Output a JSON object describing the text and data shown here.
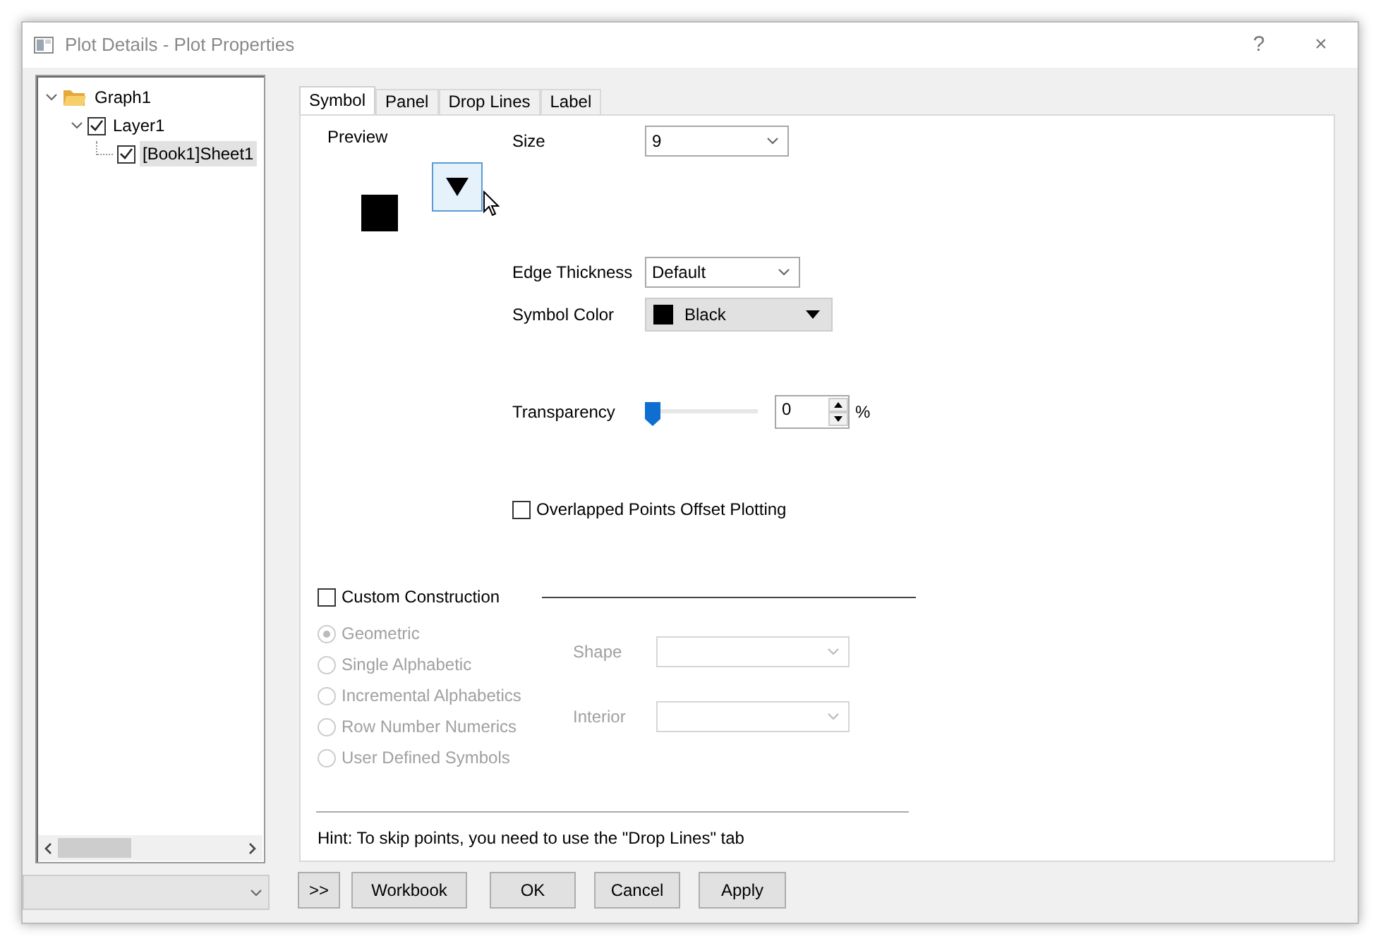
{
  "window": {
    "title": "Plot Details - Plot Properties",
    "help": "?",
    "close": "×"
  },
  "tree": [
    {
      "label": "Graph1",
      "kind": "folder",
      "expanded": true,
      "children": [
        {
          "label": "Layer1",
          "kind": "check",
          "checked": true,
          "expanded": true,
          "children": [
            {
              "label": "[Book1]Sheet1",
              "kind": "check",
              "checked": true,
              "selected": true
            }
          ]
        }
      ]
    }
  ],
  "tabs": [
    {
      "label": "Symbol",
      "selected": true
    },
    {
      "label": "Panel",
      "selected": false
    },
    {
      "label": "Drop Lines",
      "selected": false
    },
    {
      "label": "Label",
      "selected": false
    }
  ],
  "preview": {
    "label": "Preview"
  },
  "size": {
    "label": "Size",
    "value": "9"
  },
  "edge_thickness": {
    "label": "Edge Thickness",
    "value": "Default"
  },
  "symbol_color": {
    "label": "Symbol Color",
    "value": "Black"
  },
  "transparency": {
    "label": "Transparency",
    "level": 0,
    "value": "0",
    "unit": "%"
  },
  "overlapped": {
    "label": "Overlapped Points Offset Plotting",
    "checked": false
  },
  "custom_construction": {
    "label": "Custom Construction",
    "checked": false,
    "disabled": true,
    "options": [
      {
        "label": "Geometric",
        "selected": true
      },
      {
        "label": "Single Alphabetic",
        "selected": false
      },
      {
        "label": "Incremental Alphabetics",
        "selected": false
      },
      {
        "label": "Row Number Numerics",
        "selected": false
      },
      {
        "label": "User Defined Symbols",
        "selected": false
      }
    ],
    "shape": {
      "label": "Shape"
    },
    "interior": {
      "label": "Interior"
    }
  },
  "hint": "Hint: To skip points, you need to use the \"Drop Lines\" tab",
  "buttons": [
    ">>",
    "Workbook",
    "OK",
    "Cancel",
    "Apply"
  ]
}
